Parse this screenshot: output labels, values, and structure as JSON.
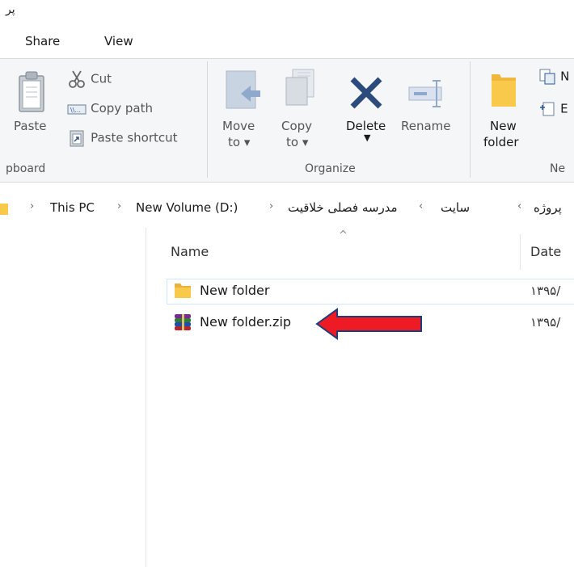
{
  "window": {
    "title_fragment": "پر"
  },
  "menu": {
    "tabs": [
      "Share",
      "View"
    ]
  },
  "ribbon": {
    "clipboard": {
      "paste": "Paste",
      "cut": "Cut",
      "copy_path": "Copy path",
      "paste_shortcut": "Paste shortcut",
      "group_label": "pboard"
    },
    "organize": {
      "move_to_1": "Move",
      "move_to_2": "to",
      "copy_to_1": "Copy",
      "copy_to_2": "to",
      "delete": "Delete",
      "rename": "Rename",
      "group_label": "Organize"
    },
    "new": {
      "new_folder_1": "New",
      "new_folder_2": "folder",
      "item_1": "N",
      "item_2": "E",
      "group_label": "Ne"
    }
  },
  "address": {
    "crumbs": [
      "This PC",
      "New Volume (D:)",
      "مدرسه فصلی خلاقیت",
      "سایت",
      "پروژه"
    ]
  },
  "list": {
    "columns": {
      "name": "Name",
      "date": "Date"
    },
    "files": [
      {
        "name": "New folder",
        "date": "۱۳۹۵/",
        "type": "folder"
      },
      {
        "name": "New folder.zip",
        "date": "۱۳۹۵/",
        "type": "zip"
      }
    ]
  },
  "colors": {
    "accent": "#2b579a",
    "folder": "#f8c94a",
    "arrow": "#ee1b24",
    "arrow_border": "#1f3d7a"
  }
}
